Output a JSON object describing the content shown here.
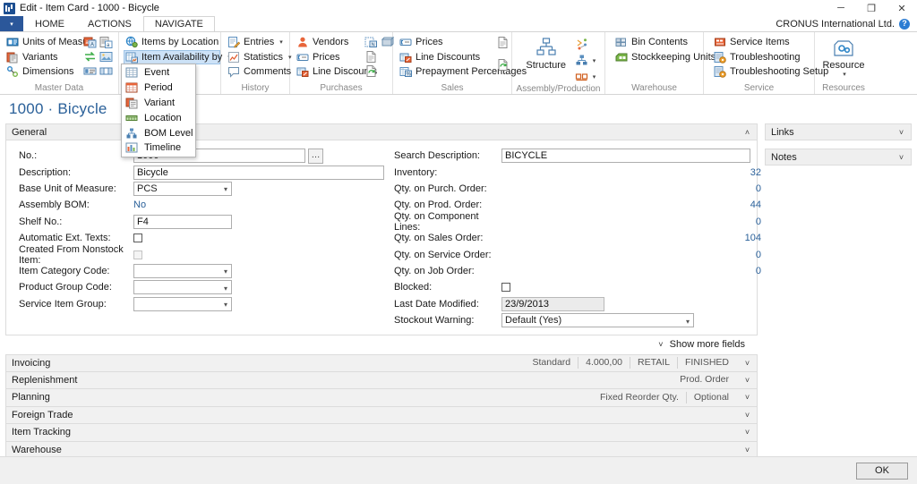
{
  "window": {
    "title": "Edit - Item Card - 1000 - Bicycle",
    "app_icon": "app-icon",
    "minimize": "─",
    "restore": "❐",
    "close": "✕"
  },
  "ribbon": {
    "app_button": "▾",
    "tabs": [
      {
        "label": "HOME",
        "active": false
      },
      {
        "label": "ACTIONS",
        "active": false
      },
      {
        "label": "NAVIGATE",
        "active": true
      }
    ],
    "company": "CRONUS International Ltd.",
    "help_icon": "?",
    "groups": [
      {
        "name": "Master Data",
        "items": [
          {
            "label": "Units of Measure",
            "icon": "units-of-measure-icon"
          },
          {
            "label": "Variants",
            "icon": "variants-icon"
          },
          {
            "label": "Dimensions",
            "icon": "dimensions-icon"
          }
        ]
      },
      {
        "name": "",
        "items": [
          {
            "label": "Items by Location",
            "icon": "items-by-location-icon"
          },
          {
            "label": "Item Availability by",
            "icon": "item-availability-icon",
            "caret": "▾",
            "selected": true
          }
        ]
      },
      {
        "name": "History",
        "items": [
          {
            "label": "Entries",
            "icon": "entries-icon",
            "caret": "▾"
          },
          {
            "label": "Statistics",
            "icon": "statistics-icon",
            "caret": "▾"
          },
          {
            "label": "Comments",
            "icon": "comments-icon"
          }
        ]
      },
      {
        "name": "Purchases",
        "items": [
          {
            "label": "Vendors",
            "icon": "vendors-icon"
          },
          {
            "label": "Prices",
            "icon": "prices-icon"
          },
          {
            "label": "Line Discounts",
            "icon": "line-discounts-icon"
          }
        ]
      },
      {
        "name": "Sales",
        "items": [
          {
            "label": "Prices",
            "icon": "prices-icon"
          },
          {
            "label": "Line Discounts",
            "icon": "line-discounts-icon"
          },
          {
            "label": "Prepayment Percentages",
            "icon": "prepayment-percentages-icon"
          }
        ]
      },
      {
        "name": "Assembly/Production",
        "items": [
          {
            "label": "Structure",
            "icon": "structure-icon"
          }
        ]
      },
      {
        "name": "Warehouse",
        "items": [
          {
            "label": "Bin Contents",
            "icon": "bin-contents-icon"
          },
          {
            "label": "Stockkeeping Units",
            "icon": "stockkeeping-units-icon"
          }
        ]
      },
      {
        "name": "Service",
        "items": [
          {
            "label": "Service Items",
            "icon": "service-items-icon"
          },
          {
            "label": "Troubleshooting",
            "icon": "troubleshooting-icon"
          },
          {
            "label": "Troubleshooting Setup",
            "icon": "troubleshooting-setup-icon"
          }
        ]
      },
      {
        "name": "Resources",
        "items": [
          {
            "label": "Resource",
            "icon": "resource-icon",
            "caret": "▾"
          }
        ]
      }
    ]
  },
  "dropdown": {
    "open": true,
    "items": [
      {
        "label": "Event",
        "icon": "event-icon"
      },
      {
        "label": "Period",
        "icon": "period-icon"
      },
      {
        "label": "Variant",
        "icon": "variant-icon"
      },
      {
        "label": "Location",
        "icon": "location-icon"
      },
      {
        "label": "BOM Level",
        "icon": "bom-level-icon"
      },
      {
        "label": "Timeline",
        "icon": "timeline-icon"
      }
    ]
  },
  "page": {
    "title": "1000 · Bicycle",
    "general": {
      "header": "General",
      "chevron": "˄",
      "left_fields": [
        {
          "label": "No.:",
          "value": "1000",
          "type": "text-ellipsis"
        },
        {
          "label": "Description:",
          "value": "Bicycle",
          "type": "text"
        },
        {
          "label": "Base Unit of Measure:",
          "value": "PCS",
          "type": "select"
        },
        {
          "label": "Assembly BOM:",
          "value": "No",
          "type": "link"
        },
        {
          "label": "Shelf No.:",
          "value": "F4",
          "type": "text"
        },
        {
          "label": "Automatic Ext. Texts:",
          "value": "",
          "type": "checkbox",
          "checked": false
        },
        {
          "label": "Created From Nonstock Item:",
          "value": "",
          "type": "checkbox-disabled",
          "checked": false
        },
        {
          "label": "Item Category Code:",
          "value": "",
          "type": "select"
        },
        {
          "label": "Product Group Code:",
          "value": "",
          "type": "select"
        },
        {
          "label": "Service Item Group:",
          "value": "",
          "type": "select"
        }
      ],
      "right_fields": [
        {
          "label": "Search Description:",
          "value": "BICYCLE",
          "type": "text"
        },
        {
          "label": "Inventory:",
          "value": "32",
          "type": "number"
        },
        {
          "label": "Qty. on Purch. Order:",
          "value": "0",
          "type": "number"
        },
        {
          "label": "Qty. on Prod. Order:",
          "value": "44",
          "type": "number"
        },
        {
          "label": "Qty. on Component Lines:",
          "value": "0",
          "type": "number"
        },
        {
          "label": "Qty. on Sales Order:",
          "value": "104",
          "type": "number"
        },
        {
          "label": "Qty. on Service Order:",
          "value": "0",
          "type": "number"
        },
        {
          "label": "Qty. on Job Order:",
          "value": "0",
          "type": "number"
        },
        {
          "label": "Blocked:",
          "value": "",
          "type": "checkbox",
          "checked": false
        },
        {
          "label": "Last Date Modified:",
          "value": "23/9/2013",
          "type": "text-readonly"
        },
        {
          "label": "Stockout Warning:",
          "value": "Default (Yes)",
          "type": "select"
        }
      ],
      "show_more": "Show more fields",
      "show_more_chevron": "˅"
    },
    "fasttabs": [
      {
        "label": "Invoicing",
        "values": [
          "Standard",
          "4.000,00",
          "RETAIL",
          "FINISHED"
        ],
        "chevron": "˅"
      },
      {
        "label": "Replenishment",
        "values": [
          "Prod. Order"
        ],
        "chevron": "˅"
      },
      {
        "label": "Planning",
        "values": [
          "Fixed Reorder Qty.",
          "Optional"
        ],
        "chevron": "˅"
      },
      {
        "label": "Foreign Trade",
        "values": [],
        "chevron": "˅"
      },
      {
        "label": "Item Tracking",
        "values": [],
        "chevron": "˅"
      },
      {
        "label": "Warehouse",
        "values": [
          ""
        ],
        "chevron": "˅"
      }
    ],
    "side_panels": [
      {
        "label": "Links",
        "chevron": "˅"
      },
      {
        "label": "Notes",
        "chevron": "˅"
      }
    ]
  },
  "footer": {
    "ok_label": "OK"
  },
  "colors": {
    "accent_blue": "#2a6099",
    "app_blue": "#2b579a",
    "selected_bg": "#cde2f7",
    "ribbon_bg": "#ffffff",
    "fasttab_bg": "#f1f1f1",
    "footer_bg": "#f0f0f0"
  }
}
